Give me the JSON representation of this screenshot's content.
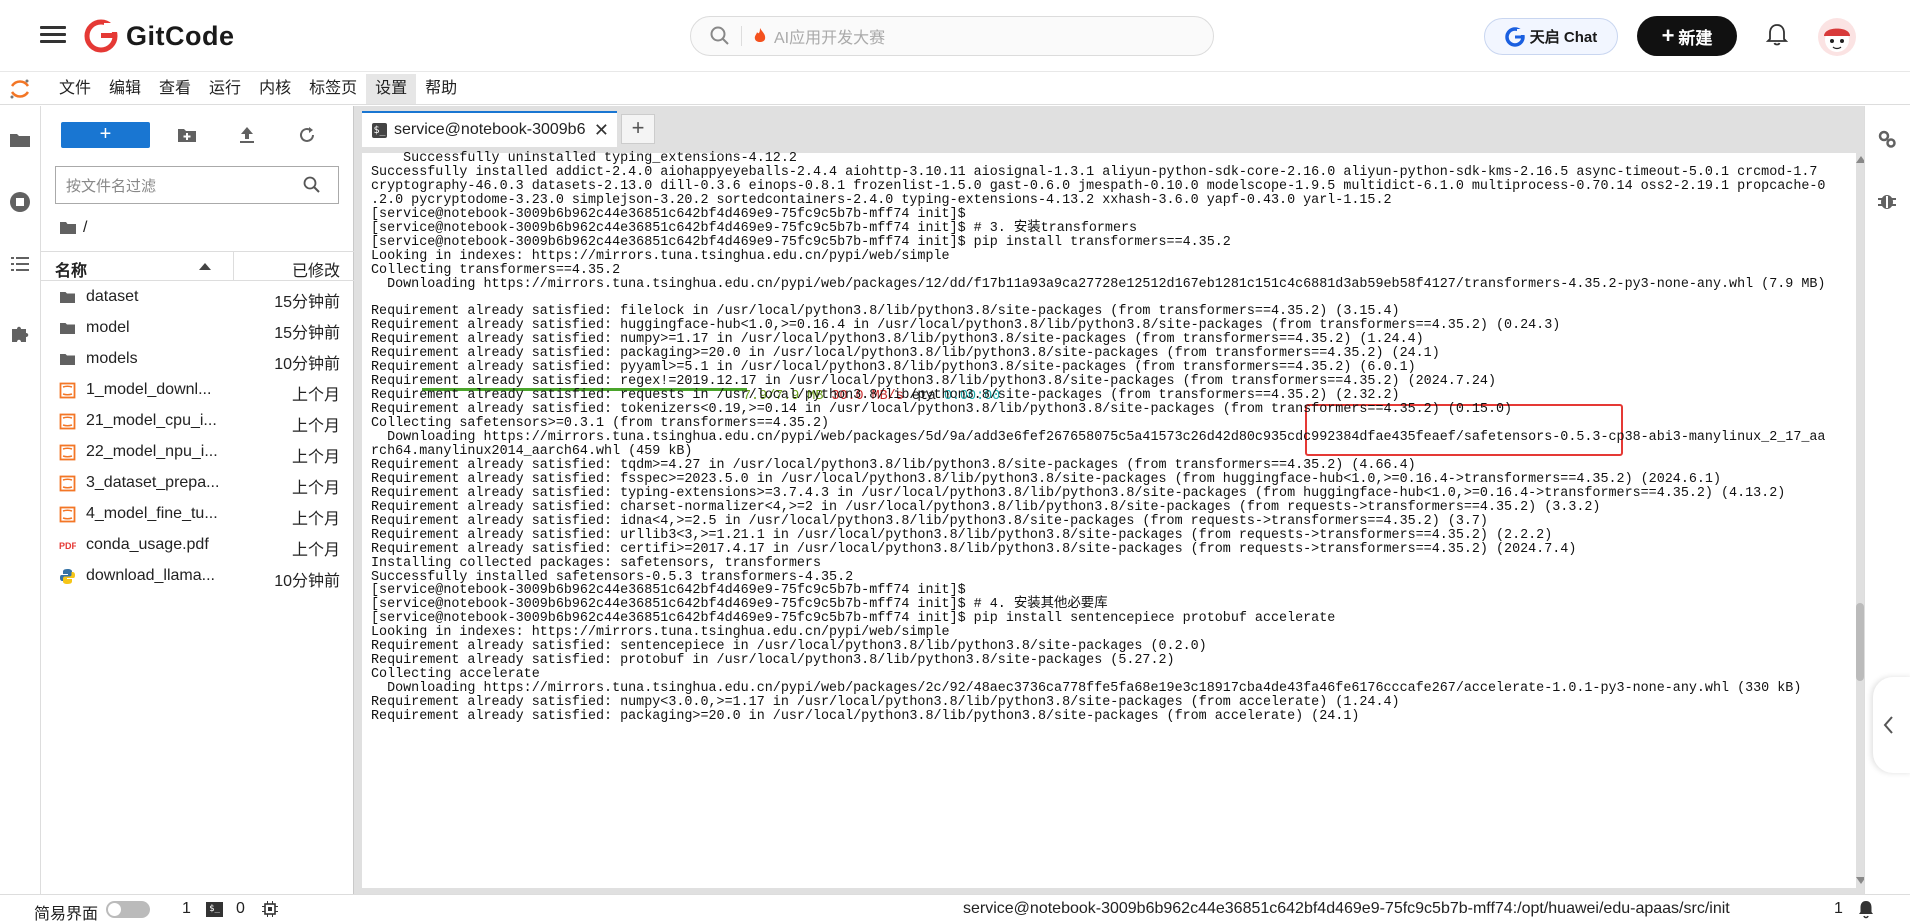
{
  "header": {
    "logo_text": "GitCode",
    "search_placeholder": "AI应用开发大赛",
    "chat_label": "天启 Chat",
    "new_label": "新建"
  },
  "menu": [
    "文件",
    "编辑",
    "查看",
    "运行",
    "内核",
    "标签页",
    "设置",
    "帮助"
  ],
  "file_panel": {
    "filter_placeholder": "按文件名过滤",
    "breadcrumb": "/",
    "col_name": "名称",
    "col_modified": "已修改",
    "files": [
      {
        "name": "dataset",
        "time": "15分钟前",
        "type": "folder"
      },
      {
        "name": "model",
        "time": "15分钟前",
        "type": "folder"
      },
      {
        "name": "models",
        "time": "10分钟前",
        "type": "folder"
      },
      {
        "name": "1_model_downl...",
        "time": "上个月",
        "type": "notebook"
      },
      {
        "name": "21_model_cpu_i...",
        "time": "上个月",
        "type": "notebook"
      },
      {
        "name": "22_model_npu_i...",
        "time": "上个月",
        "type": "notebook"
      },
      {
        "name": "3_dataset_prepa...",
        "time": "上个月",
        "type": "notebook"
      },
      {
        "name": "4_model_fine_tu...",
        "time": "上个月",
        "type": "notebook"
      },
      {
        "name": "conda_usage.pdf",
        "time": "上个月",
        "type": "pdf"
      },
      {
        "name": "download_llama...",
        "time": "10分钟前",
        "type": "python"
      }
    ]
  },
  "tab": {
    "label": "service@notebook-3009b6",
    "close": "✕",
    "add": "+"
  },
  "terminal": {
    "lines": [
      "    Successfully uninstalled typing_extensions-4.12.2",
      "Successfully installed addict-2.4.0 aiohappyeyeballs-2.4.4 aiohttp-3.10.11 aiosignal-1.3.1 aliyun-python-sdk-core-2.16.0 aliyun-python-sdk-kms-2.16.5 async-timeout-5.0.1 crcmod-1.7",
      "cryptography-46.0.3 datasets-2.13.0 dill-0.3.6 einops-0.8.1 frozenlist-1.5.0 gast-0.6.0 jmespath-0.10.0 modelscope-1.9.5 multidict-6.1.0 multiprocess-0.70.14 oss2-2.19.1 propcache-0",
      ".2.0 pycryptodome-3.23.0 simplejson-3.20.2 sortedcontainers-2.4.0 typing-extensions-4.13.2 xxhash-3.6.0 yapf-0.43.0 yarl-1.15.2",
      "[service@notebook-3009b6b962c44e36851c642bf4d469e9-75fc9c5b7b-mff74 init]$",
      "[service@notebook-3009b6b962c44e36851c642bf4d469e9-75fc9c5b7b-mff74 init]$ # 3. 安装transformers",
      "[service@notebook-3009b6b962c44e36851c642bf4d469e9-75fc9c5b7b-mff74 init]$ pip install transformers==4.35.2",
      "Looking in indexes: https://mirrors.tuna.tsinghua.edu.cn/pypi/web/simple",
      "Collecting transformers==4.35.2",
      "  Downloading https://mirrors.tuna.tsinghua.edu.cn/pypi/web/packages/12/dd/f17b11a93a9ca27728e12512d167eb1281c151c4c6881d3ab59eb58f4127/transformers-4.35.2-py3-none-any.whl (7.9 MB)",
      "",
      "Requirement already satisfied: filelock in /usr/local/python3.8/lib/python3.8/site-packages (from transformers==4.35.2) (3.15.4)",
      "Requirement already satisfied: huggingface-hub<1.0,>=0.16.4 in /usr/local/python3.8/lib/python3.8/site-packages (from transformers==4.35.2) (0.24.3)",
      "Requirement already satisfied: numpy>=1.17 in /usr/local/python3.8/lib/python3.8/site-packages (from transformers==4.35.2) (1.24.4)",
      "Requirement already satisfied: packaging>=20.0 in /usr/local/python3.8/lib/python3.8/site-packages (from transformers==4.35.2) (24.1)",
      "Requirement already satisfied: pyyaml>=5.1 in /usr/local/python3.8/lib/python3.8/site-packages (from transformers==4.35.2) (6.0.1)",
      "Requirement already satisfied: regex!=2019.12.17 in /usr/local/python3.8/lib/python3.8/site-packages (from transformers==4.35.2) (2024.7.24)",
      "Requirement already satisfied: requests in /usr/local/python3.8/lib/python3.8/site-packages (from transformers==4.35.2) (2.32.2)",
      "Requirement already satisfied: tokenizers<0.19,>=0.14 in /usr/local/python3.8/lib/python3.8/site-packages (from transformers==4.35.2) (0.15.0)",
      "Collecting safetensors>=0.3.1 (from transformers==4.35.2)",
      "  Downloading https://mirrors.tuna.tsinghua.edu.cn/pypi/web/packages/5d/9a/add3e6fef267658075c5a41573c26d42d80c935cdc992384dfae435feaef/safetensors-0.5.3-cp38-abi3-manylinux_2_17_aa",
      "rch64.manylinux2014_aarch64.whl (459 kB)",
      "Requirement already satisfied: tqdm>=4.27 in /usr/local/python3.8/lib/python3.8/site-packages (from transformers==4.35.2) (4.66.4)",
      "Requirement already satisfied: fsspec>=2023.5.0 in /usr/local/python3.8/lib/python3.8/site-packages (from huggingface-hub<1.0,>=0.16.4->transformers==4.35.2) (2024.6.1)",
      "Requirement already satisfied: typing-extensions>=3.7.4.3 in /usr/local/python3.8/lib/python3.8/site-packages (from huggingface-hub<1.0,>=0.16.4->transformers==4.35.2) (4.13.2)",
      "Requirement already satisfied: charset-normalizer<4,>=2 in /usr/local/python3.8/lib/python3.8/site-packages (from requests->transformers==4.35.2) (3.3.2)",
      "Requirement already satisfied: idna<4,>=2.5 in /usr/local/python3.8/lib/python3.8/site-packages (from requests->transformers==4.35.2) (3.7)",
      "Requirement already satisfied: urllib3<3,>=1.21.1 in /usr/local/python3.8/lib/python3.8/site-packages (from requests->transformers==4.35.2) (2.2.2)",
      "Requirement already satisfied: certifi>=2017.4.17 in /usr/local/python3.8/lib/python3.8/site-packages (from requests->transformers==4.35.2) (2024.7.4)",
      "Installing collected packages: safetensors, transformers",
      "Successfully installed safetensors-0.5.3 transformers-4.35.2",
      "[service@notebook-3009b6b962c44e36851c642bf4d469e9-75fc9c5b7b-mff74 init]$",
      "[service@notebook-3009b6b962c44e36851c642bf4d469e9-75fc9c5b7b-mff74 init]$ # 4. 安装其他必要库",
      "[service@notebook-3009b6b962c44e36851c642bf4d469e9-75fc9c5b7b-mff74 init]$ pip install sentencepiece protobuf accelerate",
      "Looking in indexes: https://mirrors.tuna.tsinghua.edu.cn/pypi/web/simple",
      "Requirement already satisfied: sentencepiece in /usr/local/python3.8/lib/python3.8/site-packages (0.2.0)",
      "Requirement already satisfied: protobuf in /usr/local/python3.8/lib/python3.8/site-packages (5.27.2)",
      "Collecting accelerate",
      "  Downloading https://mirrors.tuna.tsinghua.edu.cn/pypi/web/packages/2c/92/48aec3736ca778ffe5fa68e19e3c18917cba4de43fa46fe6176cccafe267/accelerate-1.0.1-py3-none-any.whl (330 kB)",
      "Requirement already satisfied: numpy<3.0.0,>=1.17 in /usr/local/python3.8/lib/python3.8/site-packages (from accelerate) (1.24.4)",
      "Requirement already satisfied: packaging>=20.0 in /usr/local/python3.8/lib/python3.8/site-packages (from accelerate) (24.1)"
    ],
    "progress": {
      "size": "7.9/7.9 MB",
      "speed": "30.0 MB/s",
      "eta_label": "eta",
      "eta": "0:00:00",
      "fraction": 1.0
    }
  },
  "statusbar": {
    "simple_label": "简易界面",
    "kernels": "1",
    "terminals": "0",
    "path": "service@notebook-3009b6b962c44e36851c642bf4d469e9-75fc9c5b7b-mff74:/opt/huawei/edu-apaas/src/init",
    "count": "1"
  },
  "colors": {
    "accent": "#1976d2",
    "progress": "#4aa42b",
    "highlight": "#e53935"
  }
}
